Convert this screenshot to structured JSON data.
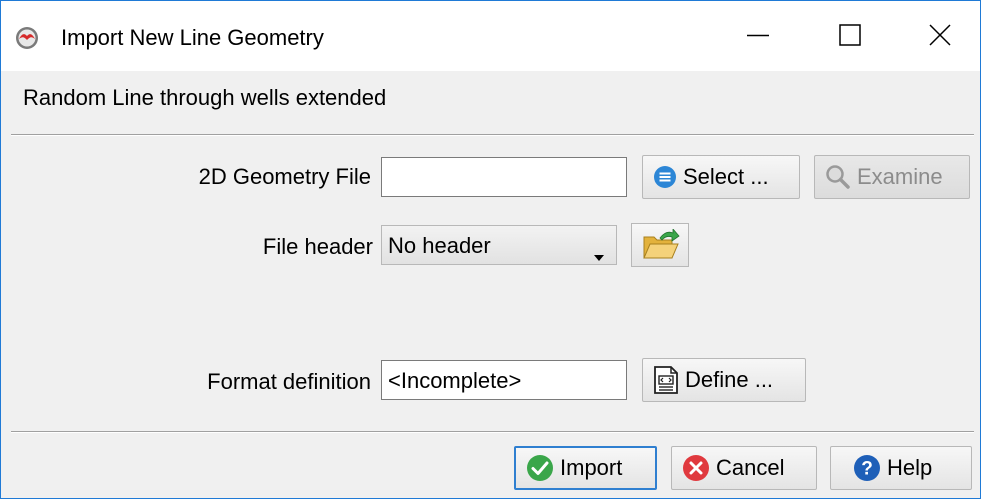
{
  "window": {
    "title": "Import New Line Geometry",
    "app_icon": "app-logo-icon",
    "controls": [
      "minimize-icon",
      "maximize-icon",
      "close-icon"
    ]
  },
  "subtitle": "Random Line through wells extended",
  "geometry_file": {
    "label": "2D Geometry File",
    "value": "",
    "select_label": "Select ...",
    "select_icon": "list-icon",
    "examine_label": "Examine",
    "examine_icon": "magnifier-icon",
    "examine_enabled": false
  },
  "file_header": {
    "label": "File header",
    "selected": "No header",
    "icon": "open-folder-icon"
  },
  "format_definition": {
    "label": "Format definition",
    "value": "<Incomplete>",
    "define_label": "Define ...",
    "define_icon": "document-edit-icon"
  },
  "footer": {
    "import_label": "Import",
    "import_icon": "checkmark-icon",
    "cancel_label": "Cancel",
    "cancel_icon": "cancel-icon",
    "help_label": "Help",
    "help_icon": "help-icon"
  },
  "colors": {
    "accent": "#1f7ad6",
    "ok_green": "#3aa64a",
    "cancel_red": "#e0393e",
    "help_blue": "#1e5fb8"
  }
}
